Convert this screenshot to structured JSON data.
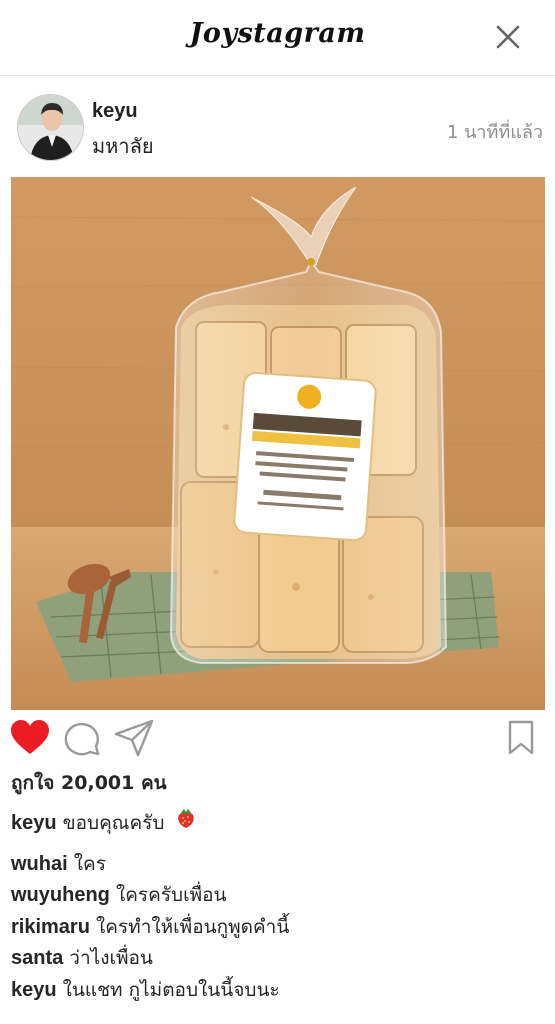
{
  "app": {
    "title": "Joystagram"
  },
  "post": {
    "username": "keyu",
    "location": "มหาลัย",
    "timestamp": "1 นาทีที่แล้ว",
    "likes_text": "ถูกใจ 20,001 คน",
    "liked": true,
    "photo_description_icon": "bread-bag-photo",
    "caption": {
      "user": "keyu",
      "text": "ขอบคุณครับ",
      "emoji": "strawberry-icon"
    },
    "comments": [
      {
        "user": "wuhai",
        "text": "ใคร"
      },
      {
        "user": "wuyuheng",
        "text": "ใครครับเพื่อน"
      },
      {
        "user": "rikimaru",
        "text": "ใครทำให้เพื่อนกูพูดคำนี้"
      },
      {
        "user": "santa",
        "text": "ว่าไงเพื่อน"
      },
      {
        "user": "keyu",
        "text": "ในแชท กูไม่ตอบในนี้จบนะ"
      }
    ]
  },
  "icons": {
    "close": "close-icon",
    "like": "heart-icon",
    "comment": "comment-icon",
    "share": "send-icon",
    "save": "bookmark-icon"
  },
  "colors": {
    "like_red": "#ed1c24",
    "muted_gray": "#8e8e8e",
    "text": "#262626"
  }
}
